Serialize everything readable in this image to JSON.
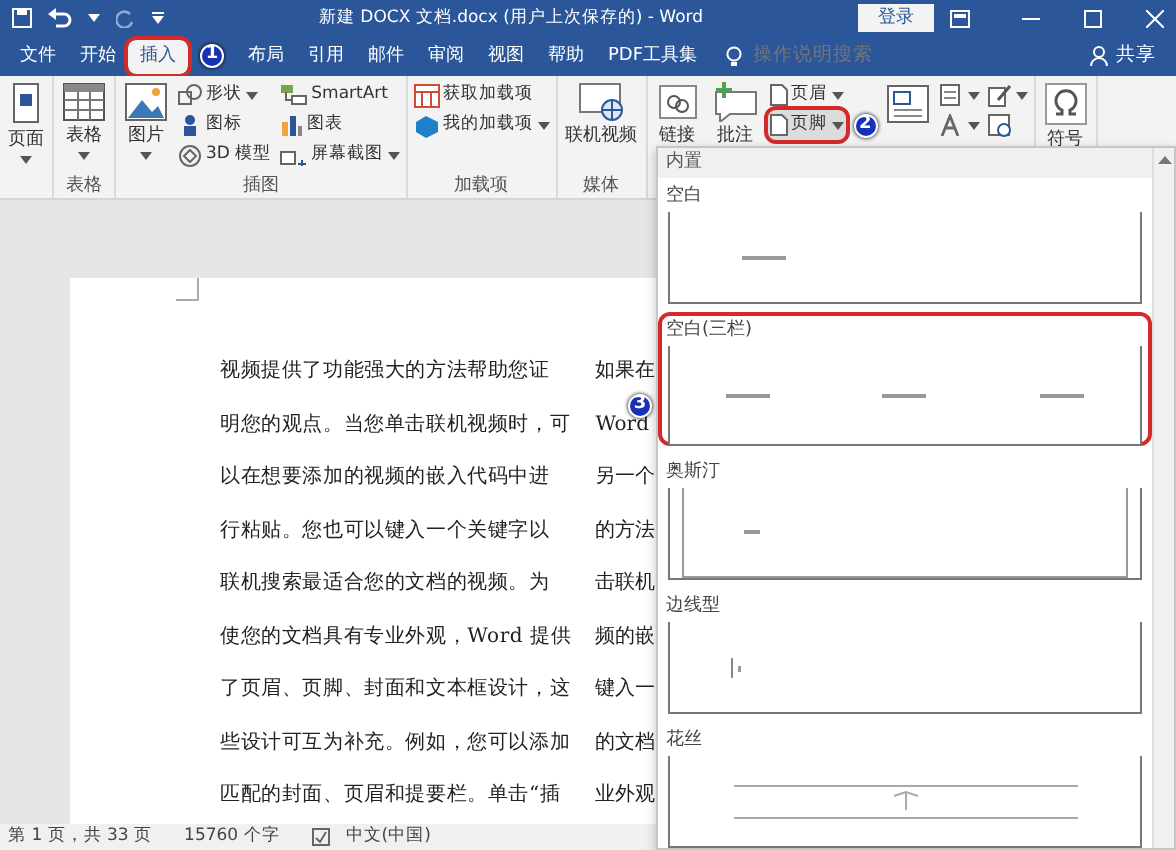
{
  "window": {
    "title": "新建 DOCX 文档.docx (用户上次保存的) - Word",
    "sign_in": "登录"
  },
  "tabs": [
    {
      "label": "文件",
      "selected": false,
      "highlighted": false
    },
    {
      "label": "开始",
      "selected": false,
      "highlighted": false
    },
    {
      "label": "插入",
      "selected": true,
      "highlighted": true,
      "badge": "1"
    },
    {
      "label": "布局",
      "selected": false,
      "highlighted": false
    },
    {
      "label": "引用",
      "selected": false,
      "highlighted": false
    },
    {
      "label": "邮件",
      "selected": false,
      "highlighted": false
    },
    {
      "label": "审阅",
      "selected": false,
      "highlighted": false
    },
    {
      "label": "视图",
      "selected": false,
      "highlighted": false
    },
    {
      "label": "帮助",
      "selected": false,
      "highlighted": false
    },
    {
      "label": "PDF工具集",
      "selected": false,
      "highlighted": false
    }
  ],
  "search": {
    "placeholder": "操作说明搜索"
  },
  "share": "共享",
  "ribbon": [
    {
      "columns": [
        [
          {
            "label": "页面",
            "kind": "large",
            "has_menu": true,
            "highlighted": false
          }
        ]
      ]
    },
    {
      "label": "表格",
      "columns": [
        [
          {
            "label": "表格",
            "kind": "large",
            "has_menu": true,
            "highlighted": false
          }
        ]
      ]
    },
    {
      "label": "插图",
      "columns": [
        [
          {
            "label": "图片",
            "kind": "large",
            "has_menu": true,
            "highlighted": false
          }
        ],
        [
          {
            "label": "形状",
            "kind": "small",
            "has_menu": true,
            "highlighted": false
          },
          {
            "label": "图标",
            "kind": "small",
            "has_menu": false,
            "highlighted": false
          },
          {
            "label": "3D 模型",
            "kind": "small",
            "has_menu": false,
            "highlighted": false
          }
        ],
        [
          {
            "label": "SmartArt",
            "kind": "small",
            "has_menu": false,
            "highlighted": false
          },
          {
            "label": "图表",
            "kind": "small",
            "has_menu": false,
            "highlighted": false
          },
          {
            "label": "屏幕截图",
            "kind": "small",
            "has_menu": true,
            "highlighted": false
          }
        ]
      ]
    },
    {
      "label": "加载项",
      "columns": [
        [
          {
            "label": "获取加载项",
            "kind": "small",
            "has_menu": false,
            "highlighted": false
          },
          {
            "label": "我的加载项",
            "kind": "small",
            "has_menu": true,
            "highlighted": false
          }
        ]
      ]
    },
    {
      "label": "媒体",
      "columns": [
        [
          {
            "label": "联机视频",
            "kind": "large",
            "has_menu": false,
            "highlighted": false
          }
        ]
      ]
    },
    {
      "columns": [
        [
          {
            "label": "链接",
            "kind": "large",
            "has_menu": false,
            "highlighted": false
          }
        ],
        [
          {
            "label": "批注",
            "kind": "large",
            "has_menu": false,
            "highlighted": false
          }
        ],
        [
          {
            "label": "页眉",
            "kind": "small",
            "has_menu": true,
            "highlighted": false
          },
          {
            "label": "页脚",
            "kind": "small",
            "has_menu": true,
            "highlighted": true,
            "badge": "2"
          }
        ],
        [
          {
            "kind": "large",
            "has_menu": false,
            "highlighted": false
          }
        ],
        [
          {
            "kind": "small",
            "has_menu": true,
            "highlighted": false
          },
          {
            "kind": "small",
            "has_menu": true,
            "highlighted": false
          }
        ],
        [
          {
            "kind": "small",
            "has_menu": true,
            "highlighted": false
          },
          {
            "kind": "small",
            "has_menu": false,
            "highlighted": false
          }
        ]
      ]
    },
    {
      "columns": [
        [
          {
            "label": "符号",
            "kind": "large",
            "has_menu": false,
            "highlighted": false
          }
        ]
      ]
    }
  ],
  "document": {
    "column_1": [
      "视频提供了功能强大的方法帮助您证",
      "明您的观点。当您单击联机视频时，可",
      "以在想要添加的视频的嵌入代码中进",
      "行粘贴。您也可以键入一个关键字以",
      "联机搜索最适合您的文档的视频。为",
      "使您的文档具有专业外观，Word 提供",
      "了页眉、页脚、封面和文本框设计，这",
      "些设计可互为补充。例如，您可以添加",
      "匹配的封面、页眉和提要栏。单击“插"
    ],
    "column_2": [
      "如果在",
      "Word",
      "另一个",
      "的方法",
      "击联机",
      "频的嵌",
      "键入一",
      "的文档",
      "业外观"
    ]
  },
  "footer_gallery": {
    "heading": "内置",
    "items": [
      {
        "label": "空白",
        "kind": "blank",
        "highlighted": false
      },
      {
        "label": "空白(三栏)",
        "kind": "three_column",
        "highlighted": true,
        "badge": "3"
      },
      {
        "label": "奥斯汀",
        "kind": "framed",
        "highlighted": false
      },
      {
        "label": "边线型",
        "kind": "sideline",
        "highlighted": false
      },
      {
        "label": "花丝",
        "kind": "filigree",
        "highlighted": false
      }
    ]
  },
  "status_bar": [
    "第 1 页，共 33 页",
    "15760 个字",
    "中文(中国)"
  ]
}
